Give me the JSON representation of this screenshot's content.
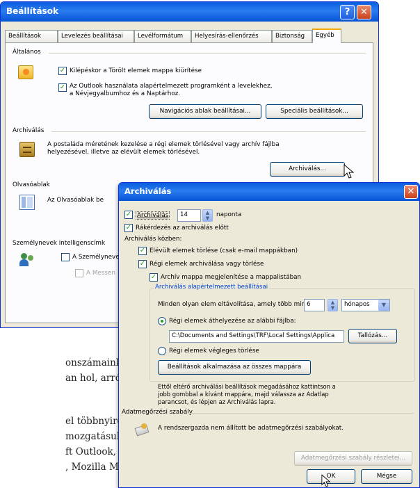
{
  "settings_window": {
    "title": "Beállítások",
    "tabs": [
      "Beállítások",
      "Levelezés beállításai",
      "Levélformátum",
      "Helyesírás-ellenőrzés",
      "Biztonság",
      "Egyéb"
    ],
    "active_tab": "Egyéb",
    "general": {
      "label": "Általános",
      "option1": "Kilépéskor a Törölt elemek mappa kiürítése",
      "option2_line1": "Az Outlook használata alapértelmezett programként a levelekhez,",
      "option2_line2": "a Névjegyalbumhoz és a Naptárhoz.",
      "nav_button": "Navigációs ablak beállításai...",
      "special_button": "Speciális beállítások..."
    },
    "archiving": {
      "label": "Archiválás",
      "desc_line1": "A postaláda méretének kezelése a régi elemek törlésével vagy archív fájlba",
      "desc_line2": "helyezésével, illetve az elévült elemek törlésével.",
      "button": "Archiválás..."
    },
    "reading_pane": {
      "label": "Olvasóablak",
      "desc": "Az Olvasóablak be"
    },
    "persons": {
      "label": "Személynevek intelligenscímk",
      "option1": "A Személyneve",
      "option2": "A Messen"
    }
  },
  "archive_dialog": {
    "title": "Archiválás",
    "every_label": "Archiválás",
    "every_value": "14",
    "every_unit": "naponta",
    "prompt_label": "Rákérdezés az archiválás előtt",
    "during_label": "Archiválás közben:",
    "delete_expired": "Elévült elemek törlése (csak e-mail mappákban)",
    "archive_old": "Régi elemek archiválása vagy törlése",
    "show_folder": "Archív mappa megjelenítése a mappalistában",
    "defaults_legend": "Archiválás alapértelmezett beállításai",
    "older_than_label": "Minden olyan elem eltávolítása, amely több mint",
    "older_than_value": "6",
    "older_than_unit": "hónapos",
    "move_old_label": "Régi elemek áthelyezése az alábbi fájlba:",
    "path_value": "C:\\Documents and Settings\\TRF\\Local Settings\\Applica",
    "browse_button": "Tallózás...",
    "permanent_delete": "Régi elemek végleges törlése",
    "apply_all_button": "Beállítások alkalmazása az összes mappára",
    "note_line1": "Ettől eltérő archiválási beállítások megadásához kattintson a",
    "note_line2": "jobb gombbal a kívánt mappára, majd válassza az Adatlap",
    "note_line3": "parancsot, és lépjen az Archiválás lapra.",
    "retention_label": "Adatmegőrzési szabály",
    "retention_text": "A rendszergazda nem állított be adatmegőrzési szabályokat.",
    "retention_button": "Adatmegőrzési szabály részletei...",
    "ok_button": "OK",
    "cancel_button": "Mégse"
  },
  "magazine_text": [
    "onszámaink",
    "an hol, arról",
    "el többnyire",
    "mozgatásukra",
    "ft Outlook,",
    ", Mozilla Mail,"
  ],
  "colors": {
    "xp_blue": "#0a5ddc",
    "dialog_bg": "#ece9d8",
    "check_green": "#21a121"
  }
}
